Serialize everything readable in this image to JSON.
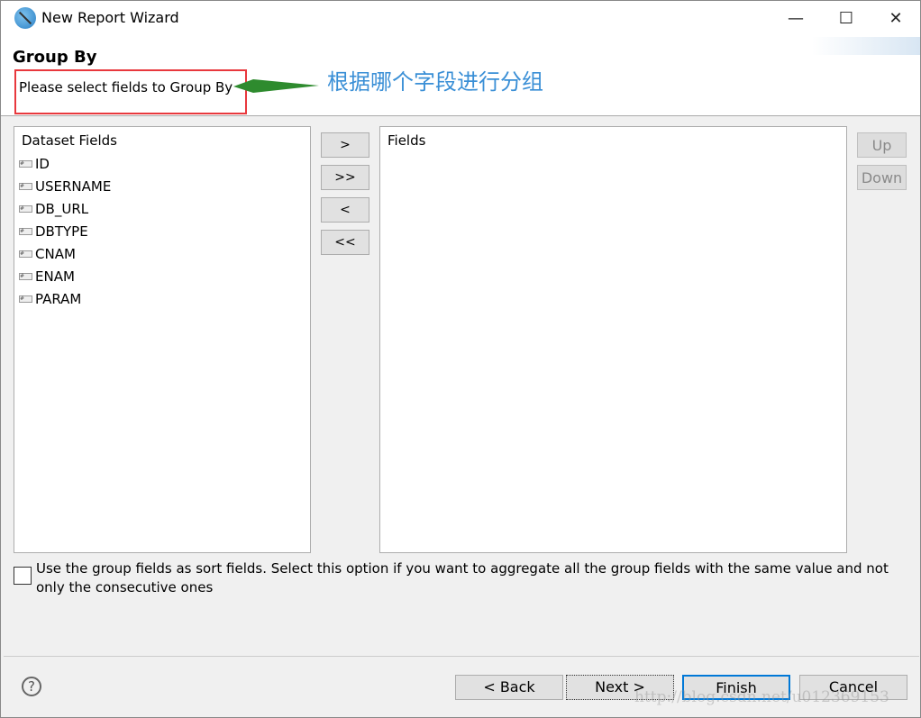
{
  "window": {
    "title": "New Report Wizard",
    "minimize": "—",
    "maximize": "☐",
    "close": "✕"
  },
  "header": {
    "title": "Group By",
    "description": "Please select fields to Group By",
    "annotation": "根据哪个字段进行分组",
    "annotation_color": "#3a8fd6",
    "arrow_color": "#2e8b2e"
  },
  "dataset": {
    "heading": "Dataset Fields",
    "items": [
      "ID",
      "USERNAME",
      "DB_URL",
      "DBTYPE",
      "CNAM",
      "ENAM",
      "PARAM"
    ]
  },
  "fields": {
    "heading": "Fields"
  },
  "transfer": {
    "add": ">",
    "add_all": ">>",
    "remove": "<",
    "remove_all": "<<"
  },
  "order": {
    "up": "Up",
    "down": "Down"
  },
  "option": {
    "label": "Use the group fields as sort fields. Select this option if you want to aggregate all the group fields with the same value and not only the consecutive ones",
    "checked": false
  },
  "footer": {
    "help": "?",
    "back": "< Back",
    "next": "Next >",
    "finish": "Finish",
    "cancel": "Cancel"
  },
  "watermark": "http://blog.csdn.net/u012369153"
}
